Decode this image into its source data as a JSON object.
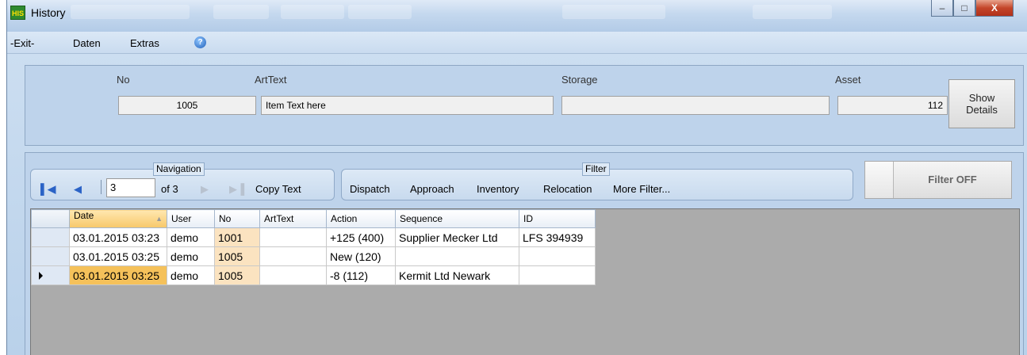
{
  "window": {
    "title": "History",
    "icon": "app-icon-his",
    "controls": [
      "minimize",
      "maximize",
      "close"
    ]
  },
  "menu": {
    "items": [
      "-Exit-",
      "Daten",
      "Extras"
    ],
    "help_icon": "help-icon"
  },
  "header": {
    "no": {
      "label": "No",
      "value": "1005"
    },
    "arttext": {
      "label": "ArtText",
      "value": "Item Text here"
    },
    "storage": {
      "label": "Storage",
      "value": ""
    },
    "asset": {
      "label": "Asset",
      "value": "112"
    },
    "show_details_line1": "Show",
    "show_details_line2": "Details"
  },
  "navigation": {
    "title": "Navigation",
    "page_value": "3",
    "of_text": "of 3",
    "copy_text": "Copy Text"
  },
  "filter": {
    "title": "Filter",
    "items": [
      "Dispatch",
      "Approach",
      "Inventory",
      "Relocation",
      "More Filter..."
    ],
    "filter_off_label": "Filter OFF"
  },
  "table": {
    "columns": [
      "Date",
      "User",
      "No",
      "ArtText",
      "Action",
      "Sequence",
      "ID"
    ],
    "sorted_column": "Date",
    "rows": [
      {
        "date": "03.01.2015 03:23",
        "user": "demo",
        "no": "1001",
        "arttext": "",
        "action": "+125 (400)",
        "sequence": "Supplier Mecker Ltd",
        "id": "LFS 394939"
      },
      {
        "date": "03.01.2015 03:25",
        "user": "demo",
        "no": "1005",
        "arttext": "",
        "action": "New (120)",
        "sequence": "",
        "id": ""
      },
      {
        "date": "03.01.2015 03:25",
        "user": "demo",
        "no": "1005",
        "arttext": "",
        "action": "-8 (112)",
        "sequence": "Kermit Ltd Newark",
        "id": ""
      }
    ],
    "selected_row": 2
  }
}
